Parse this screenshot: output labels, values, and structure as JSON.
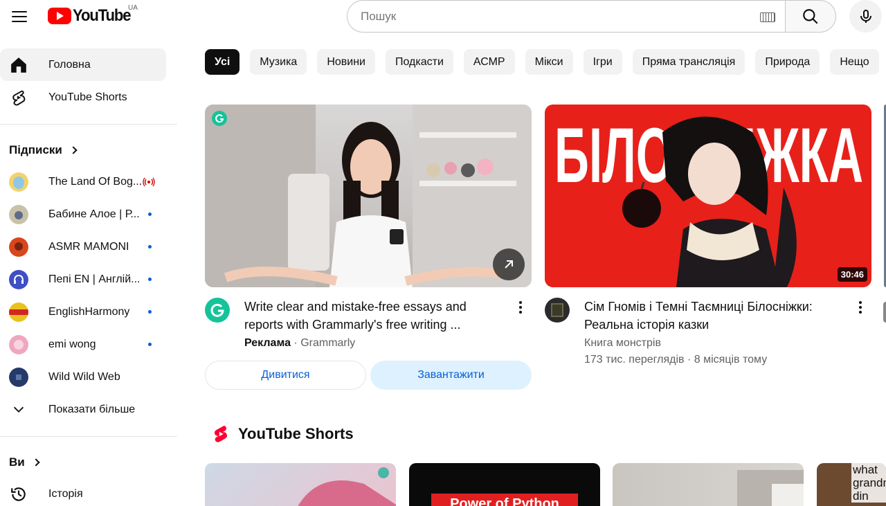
{
  "header": {
    "logo_text": "YouTube",
    "country_code": "UA",
    "search_placeholder": "Пошук"
  },
  "sidebar": {
    "main": [
      {
        "label": "Головна",
        "icon": "home-icon",
        "active": true
      },
      {
        "label": "YouTube Shorts",
        "icon": "shorts-icon",
        "active": false
      }
    ],
    "subscriptions_title": "Підписки",
    "subscriptions": [
      {
        "label": "The Land Of Bog...",
        "status": "live",
        "avatar_color": "#f2d36b"
      },
      {
        "label": "Бабине Алое | Р...",
        "status": "new",
        "avatar_color": "#c9c2a8"
      },
      {
        "label": "ASMR MAMONI",
        "status": "new",
        "avatar_color": "#d9461e"
      },
      {
        "label": "Пепі EN | Англій...",
        "status": "new",
        "avatar_color": "#3f4fc4"
      },
      {
        "label": "EnglishHarmony",
        "status": "new",
        "avatar_color": "#e8c220"
      },
      {
        "label": "emi wong",
        "status": "new",
        "avatar_color": "#f0a6c0"
      },
      {
        "label": "Wild Wild Web",
        "status": "none",
        "avatar_color": "#263a6a"
      }
    ],
    "show_more": "Показати більше",
    "you_title": "Ви",
    "history": "Історія"
  },
  "chips": [
    "Усі",
    "Музика",
    "Новини",
    "Подкасти",
    "АСМР",
    "Мікси",
    "Ігри",
    "Пряма трансляція",
    "Природа",
    "Нещо"
  ],
  "videos": [
    {
      "title": "Write clear and mistake-free essays and reports with Grammarly's free writing ...",
      "ad_label": "Реклама",
      "channel": "Grammarly",
      "watch_button": "Дивитися",
      "download_button": "Завантажити"
    },
    {
      "title": "Сім Гномів і Темні Таємниці Білосніжки: Реальна історія казки",
      "channel": "Книга монстрів",
      "views": "173 тис. переглядів",
      "age": "8 місяців тому",
      "duration": "30:46",
      "thumb_text": "БІЛОСНІЖКА"
    }
  ],
  "shorts": {
    "title": "YouTube Shorts",
    "items": [
      {
        "caption": ""
      },
      {
        "caption": "Power of Python"
      },
      {
        "caption": ""
      },
      {
        "caption": "what grandm din"
      }
    ]
  },
  "colors": {
    "brand_red": "#ff0000",
    "link_blue": "#065fd4",
    "chip_bg": "#f2f2f2"
  }
}
